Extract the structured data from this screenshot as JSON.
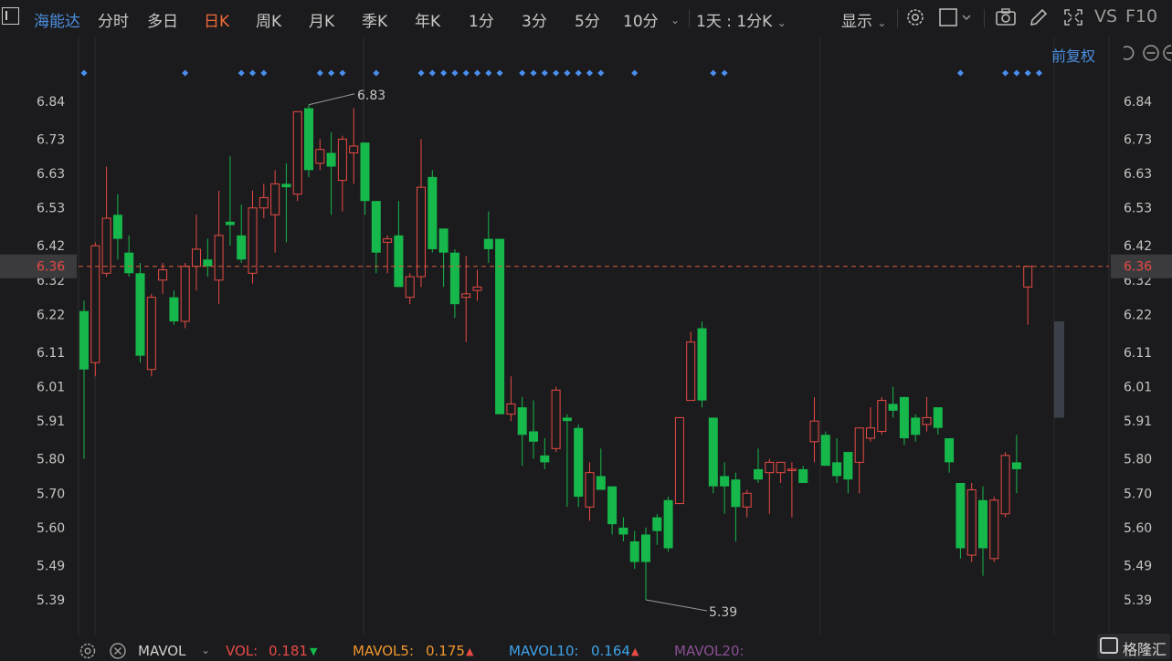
{
  "toolbar": {
    "stock_name": "海能达",
    "periods": [
      "分时",
      "多日",
      "日K",
      "周K",
      "月K",
      "季K",
      "年K",
      "1分",
      "3分",
      "5分",
      "10分"
    ],
    "active_period": "日K",
    "interval_label": "1天 : 1分K",
    "display_label": "显示",
    "vs_label": "VS",
    "f10_label": "F10"
  },
  "chart_header": {
    "adjust_label": "前复权"
  },
  "y_axis": {
    "ticks": [
      "6.84",
      "6.73",
      "6.63",
      "6.53",
      "6.42",
      "6.32",
      "6.22",
      "6.11",
      "6.01",
      "5.91",
      "5.80",
      "5.70",
      "5.60",
      "5.49",
      "5.39"
    ]
  },
  "current_price": "6.36",
  "annotations": {
    "high": "6.83",
    "low": "5.39"
  },
  "colors": {
    "up": "#e84a44",
    "down": "#16b84b",
    "marker": "#4a8ff0",
    "bg": "#1b1b1d",
    "grid": "#2c2c2e"
  },
  "chart_data": {
    "type": "candlestick",
    "ylim": [
      5.33,
      6.88
    ],
    "candles": [
      {
        "o": 6.23,
        "h": 6.26,
        "l": 5.8,
        "c": 6.06
      },
      {
        "o": 6.08,
        "h": 6.43,
        "l": 6.04,
        "c": 6.42
      },
      {
        "o": 6.34,
        "h": 6.65,
        "l": 6.33,
        "c": 6.5
      },
      {
        "o": 6.51,
        "h": 6.57,
        "l": 6.38,
        "c": 6.44
      },
      {
        "o": 6.4,
        "h": 6.45,
        "l": 6.33,
        "c": 6.34
      },
      {
        "o": 6.34,
        "h": 6.37,
        "l": 6.08,
        "c": 6.1
      },
      {
        "o": 6.06,
        "h": 6.28,
        "l": 6.04,
        "c": 6.27
      },
      {
        "o": 6.32,
        "h": 6.37,
        "l": 6.28,
        "c": 6.35
      },
      {
        "o": 6.27,
        "h": 6.29,
        "l": 6.19,
        "c": 6.2
      },
      {
        "o": 6.2,
        "h": 6.37,
        "l": 6.18,
        "c": 6.36
      },
      {
        "o": 6.36,
        "h": 6.51,
        "l": 6.29,
        "c": 6.41
      },
      {
        "o": 6.38,
        "h": 6.44,
        "l": 6.33,
        "c": 6.36
      },
      {
        "o": 6.32,
        "h": 6.58,
        "l": 6.25,
        "c": 6.45
      },
      {
        "o": 6.49,
        "h": 6.68,
        "l": 6.42,
        "c": 6.48
      },
      {
        "o": 6.45,
        "h": 6.54,
        "l": 6.37,
        "c": 6.38
      },
      {
        "o": 6.34,
        "h": 6.58,
        "l": 6.31,
        "c": 6.53
      },
      {
        "o": 6.53,
        "h": 6.6,
        "l": 6.5,
        "c": 6.56
      },
      {
        "o": 6.51,
        "h": 6.64,
        "l": 6.4,
        "c": 6.6
      },
      {
        "o": 6.6,
        "h": 6.66,
        "l": 6.43,
        "c": 6.59
      },
      {
        "o": 6.57,
        "h": 6.78,
        "l": 6.55,
        "c": 6.81
      },
      {
        "o": 6.82,
        "h": 6.83,
        "l": 6.62,
        "c": 6.64
      },
      {
        "o": 6.66,
        "h": 6.73,
        "l": 6.64,
        "c": 6.7
      },
      {
        "o": 6.69,
        "h": 6.75,
        "l": 6.51,
        "c": 6.65
      },
      {
        "o": 6.61,
        "h": 6.74,
        "l": 6.52,
        "c": 6.73
      },
      {
        "o": 6.69,
        "h": 6.82,
        "l": 6.6,
        "c": 6.71
      },
      {
        "o": 6.72,
        "h": 6.72,
        "l": 6.51,
        "c": 6.55
      },
      {
        "o": 6.55,
        "h": 6.55,
        "l": 6.34,
        "c": 6.4
      },
      {
        "o": 6.43,
        "h": 6.45,
        "l": 6.34,
        "c": 6.44
      },
      {
        "o": 6.45,
        "h": 6.55,
        "l": 6.3,
        "c": 6.3
      },
      {
        "o": 6.27,
        "h": 6.34,
        "l": 6.25,
        "c": 6.33
      },
      {
        "o": 6.33,
        "h": 6.73,
        "l": 6.3,
        "c": 6.59
      },
      {
        "o": 6.62,
        "h": 6.64,
        "l": 6.4,
        "c": 6.41
      },
      {
        "o": 6.47,
        "h": 6.47,
        "l": 6.3,
        "c": 6.4
      },
      {
        "o": 6.4,
        "h": 6.41,
        "l": 6.21,
        "c": 6.25
      },
      {
        "o": 6.27,
        "h": 6.39,
        "l": 6.14,
        "c": 6.28
      },
      {
        "o": 6.29,
        "h": 6.35,
        "l": 6.26,
        "c": 6.3
      },
      {
        "o": 6.44,
        "h": 6.52,
        "l": 6.37,
        "c": 6.41
      },
      {
        "o": 6.44,
        "h": 6.44,
        "l": 5.93,
        "c": 5.93
      },
      {
        "o": 5.93,
        "h": 6.04,
        "l": 5.91,
        "c": 5.96
      },
      {
        "o": 5.95,
        "h": 5.98,
        "l": 5.78,
        "c": 5.87
      },
      {
        "o": 5.88,
        "h": 5.97,
        "l": 5.8,
        "c": 5.85
      },
      {
        "o": 5.81,
        "h": 5.86,
        "l": 5.77,
        "c": 5.79
      },
      {
        "o": 5.83,
        "h": 6.01,
        "l": 5.82,
        "c": 6.0
      },
      {
        "o": 5.92,
        "h": 5.93,
        "l": 5.66,
        "c": 5.91
      },
      {
        "o": 5.89,
        "h": 5.9,
        "l": 5.66,
        "c": 5.69
      },
      {
        "o": 5.66,
        "h": 5.79,
        "l": 5.62,
        "c": 5.76
      },
      {
        "o": 5.75,
        "h": 5.83,
        "l": 5.71,
        "c": 5.71
      },
      {
        "o": 5.72,
        "h": 5.72,
        "l": 5.58,
        "c": 5.61
      },
      {
        "o": 5.6,
        "h": 5.63,
        "l": 5.56,
        "c": 5.58
      },
      {
        "o": 5.56,
        "h": 5.59,
        "l": 5.48,
        "c": 5.5
      },
      {
        "o": 5.58,
        "h": 5.6,
        "l": 5.39,
        "c": 5.5
      },
      {
        "o": 5.63,
        "h": 5.64,
        "l": 5.55,
        "c": 5.59
      },
      {
        "o": 5.68,
        "h": 5.69,
        "l": 5.53,
        "c": 5.54
      },
      {
        "o": 5.67,
        "h": 5.91,
        "l": 5.67,
        "c": 5.92
      },
      {
        "o": 5.97,
        "h": 6.17,
        "l": 5.97,
        "c": 6.14
      },
      {
        "o": 6.18,
        "h": 6.2,
        "l": 5.95,
        "c": 5.97
      },
      {
        "o": 5.92,
        "h": 5.92,
        "l": 5.7,
        "c": 5.72
      },
      {
        "o": 5.75,
        "h": 5.79,
        "l": 5.64,
        "c": 5.72
      },
      {
        "o": 5.74,
        "h": 5.76,
        "l": 5.56,
        "c": 5.66
      },
      {
        "o": 5.66,
        "h": 5.71,
        "l": 5.63,
        "c": 5.7
      },
      {
        "o": 5.77,
        "h": 5.83,
        "l": 5.73,
        "c": 5.74
      },
      {
        "o": 5.76,
        "h": 5.8,
        "l": 5.64,
        "c": 5.79
      },
      {
        "o": 5.76,
        "h": 5.79,
        "l": 5.73,
        "c": 5.79
      },
      {
        "o": 5.77,
        "h": 5.79,
        "l": 5.63,
        "c": 5.77
      },
      {
        "o": 5.77,
        "h": 5.78,
        "l": 5.73,
        "c": 5.73
      },
      {
        "o": 5.85,
        "h": 5.98,
        "l": 5.79,
        "c": 5.91
      },
      {
        "o": 5.87,
        "h": 5.88,
        "l": 5.78,
        "c": 5.78
      },
      {
        "o": 5.79,
        "h": 5.86,
        "l": 5.73,
        "c": 5.75
      },
      {
        "o": 5.82,
        "h": 5.82,
        "l": 5.7,
        "c": 5.74
      },
      {
        "o": 5.79,
        "h": 5.89,
        "l": 5.7,
        "c": 5.89
      },
      {
        "o": 5.86,
        "h": 5.95,
        "l": 5.85,
        "c": 5.89
      },
      {
        "o": 5.88,
        "h": 5.98,
        "l": 5.87,
        "c": 5.97
      },
      {
        "o": 5.96,
        "h": 6.01,
        "l": 5.92,
        "c": 5.94
      },
      {
        "o": 5.98,
        "h": 5.98,
        "l": 5.84,
        "c": 5.86
      },
      {
        "o": 5.92,
        "h": 5.93,
        "l": 5.85,
        "c": 5.87
      },
      {
        "o": 5.9,
        "h": 5.98,
        "l": 5.88,
        "c": 5.92
      },
      {
        "o": 5.95,
        "h": 5.95,
        "l": 5.87,
        "c": 5.89
      },
      {
        "o": 5.86,
        "h": 5.86,
        "l": 5.76,
        "c": 5.79
      },
      {
        "o": 5.73,
        "h": 5.73,
        "l": 5.51,
        "c": 5.54
      },
      {
        "o": 5.52,
        "h": 5.73,
        "l": 5.5,
        "c": 5.71
      },
      {
        "o": 5.68,
        "h": 5.72,
        "l": 5.46,
        "c": 5.54
      },
      {
        "o": 5.51,
        "h": 5.69,
        "l": 5.5,
        "c": 5.68
      },
      {
        "o": 5.64,
        "h": 5.82,
        "l": 5.63,
        "c": 5.81
      },
      {
        "o": 5.79,
        "h": 5.87,
        "l": 5.7,
        "c": 5.77
      },
      {
        "o": 6.3,
        "h": 6.36,
        "l": 6.19,
        "c": 6.36
      }
    ],
    "markers": [
      0,
      9,
      14,
      15,
      16,
      21,
      22,
      23,
      26,
      30,
      31,
      32,
      33,
      34,
      35,
      36,
      37,
      39,
      40,
      41,
      42,
      43,
      44,
      45,
      46,
      49,
      56,
      57,
      78,
      82,
      83,
      84,
      85
    ]
  },
  "volume_bar": {
    "label": "MAVOL",
    "vol_label": "VOL:",
    "vol_value": "0.181",
    "mavol5_label": "MAVOL5:",
    "mavol5_value": "0.175",
    "mavol10_label": "MAVOL10:",
    "mavol10_value": "0.164",
    "mavol20_label": "MAVOL20:"
  },
  "watermark": "格隆汇"
}
